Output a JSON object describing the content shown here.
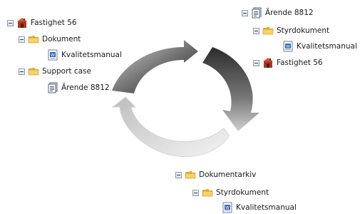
{
  "left_tree": {
    "root": {
      "label": "Fastighet 56",
      "icon": "property-icon"
    },
    "dokument": {
      "label": "Dokument",
      "icon": "folder-icon"
    },
    "kvalitet": {
      "label": "Kvalitetsmanual",
      "icon": "word-document-icon"
    },
    "support": {
      "label": "Support case",
      "icon": "folder-icon"
    },
    "arende": {
      "label": "Ärende 8812",
      "icon": "case-document-icon"
    }
  },
  "right_tree": {
    "root": {
      "label": "Ärende 8812",
      "icon": "case-document-icon"
    },
    "styr": {
      "label": "Styrdokument",
      "icon": "folder-icon"
    },
    "kvalitet": {
      "label": "Kvalitetsmanual",
      "icon": "word-document-icon"
    },
    "fastighet": {
      "label": "Fastighet 56",
      "icon": "property-icon"
    }
  },
  "bottom_tree": {
    "root": {
      "label": "Dokumentarkiv",
      "icon": "folder-icon"
    },
    "styr": {
      "label": "Styrdokument",
      "icon": "folder-icon"
    },
    "kvalitet": {
      "label": "Kvalitetsmanual",
      "icon": "word-document-icon"
    }
  },
  "colors": {
    "arrow_dark": "#3a3a3a",
    "arrow_light": "#f2f2f2",
    "folder": "#f3c64a",
    "property": "#a83a20"
  }
}
